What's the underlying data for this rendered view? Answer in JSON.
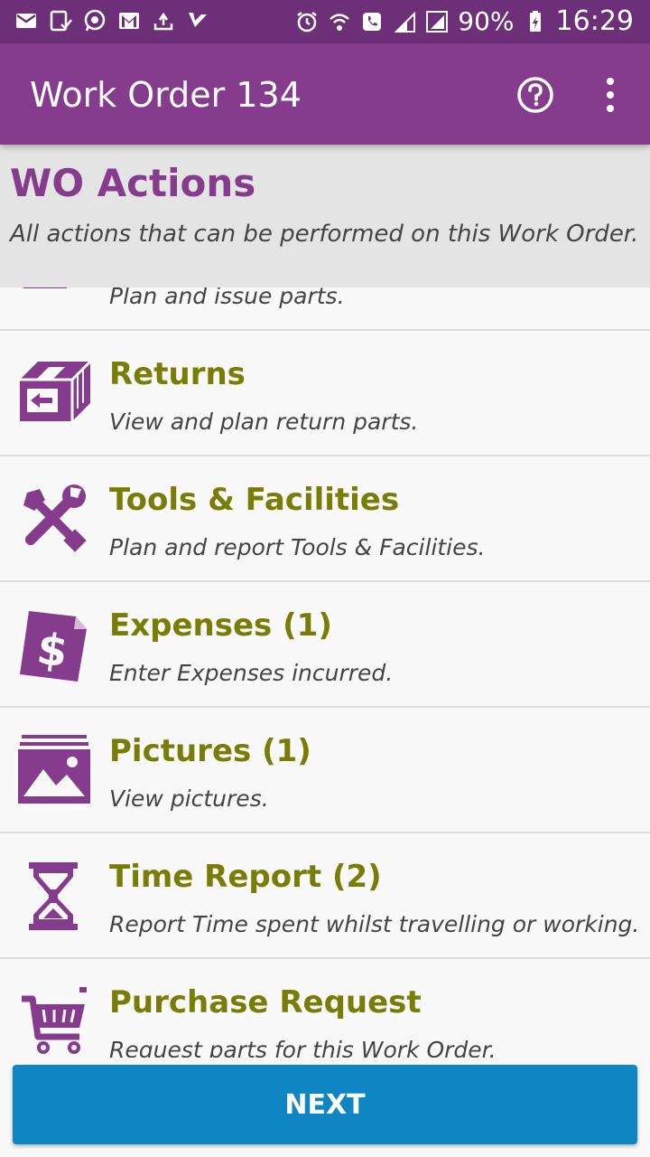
{
  "status_bar": {
    "battery_percent": "90%",
    "time": "16:29",
    "left_icons": [
      "mail-icon",
      "voicemail-icon",
      "whatsapp-icon",
      "gmail-icon",
      "sync-icon",
      "check-icon"
    ],
    "right_icons": [
      "alarm-icon",
      "wifi-call-icon",
      "phone-icon",
      "signal-icon",
      "signal-2-icon",
      "battery-charging-icon"
    ]
  },
  "app_bar": {
    "title": "Work Order 134",
    "icons": [
      "help-icon",
      "more-vert-icon"
    ]
  },
  "section": {
    "title": "WO Actions",
    "subtitle": "All actions that can be performed on this Work Order."
  },
  "actions": [
    {
      "title": "",
      "description": "Plan and issue parts.",
      "icon": "parts-icon"
    },
    {
      "title": "Returns",
      "description": "View and plan return parts.",
      "icon": "returns-box-icon"
    },
    {
      "title": "Tools & Facilities",
      "description": "Plan and report Tools & Facilities.",
      "icon": "tools-icon"
    },
    {
      "title": "Expenses (1)",
      "description": "Enter Expenses incurred.",
      "icon": "expenses-icon"
    },
    {
      "title": "Pictures (1)",
      "description": "View pictures.",
      "icon": "pictures-icon"
    },
    {
      "title": "Time Report (2)",
      "description": "Report Time spent whilst travelling or working.",
      "icon": "hourglass-icon"
    },
    {
      "title": "Purchase Request",
      "description": "Request parts for this Work Order.",
      "icon": "shopping-cart-icon"
    }
  ],
  "footer": {
    "next_label": "NEXT"
  },
  "colors": {
    "status_bar": "#6c2f78",
    "app_bar": "#853c8d",
    "accent_purple": "#853c8d",
    "item_title": "#7a7d05",
    "next_button": "#0f86c3"
  }
}
